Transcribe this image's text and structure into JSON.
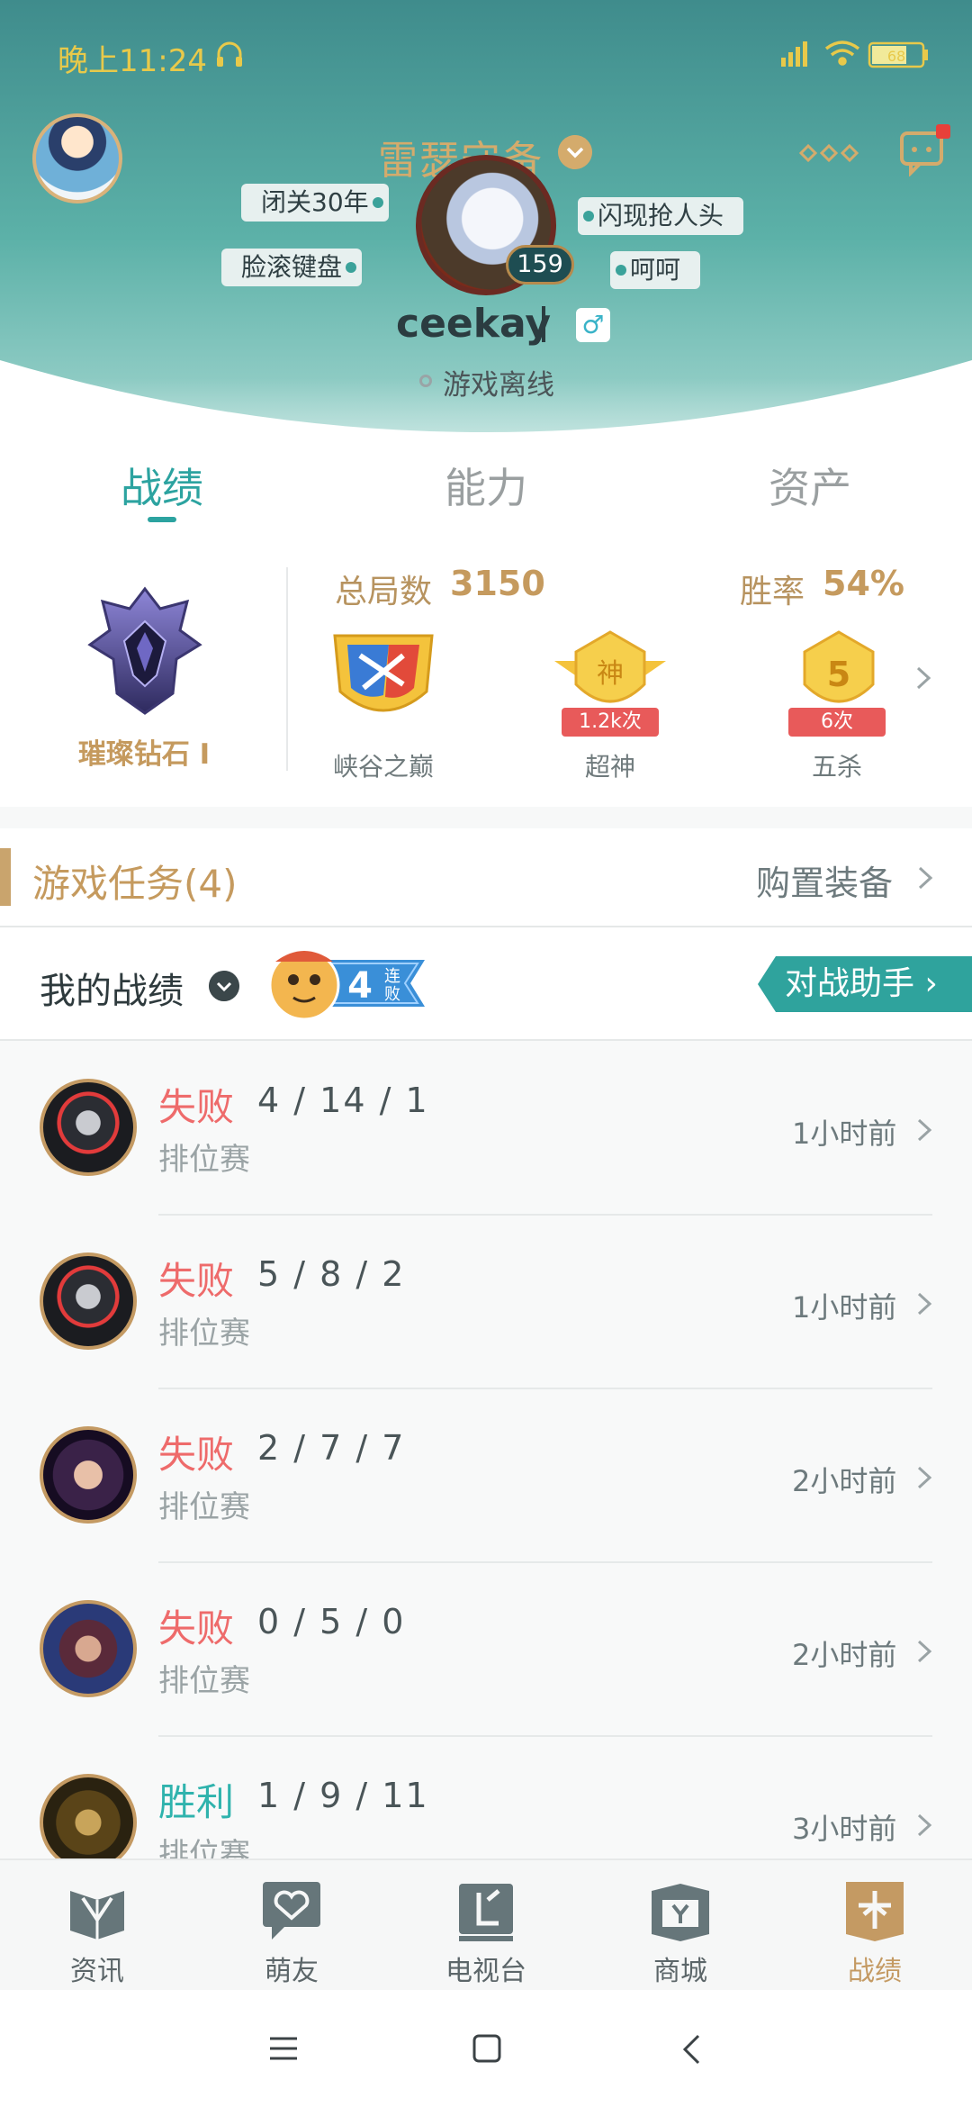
{
  "status_bar": {
    "time": "晚上11:24",
    "battery": "68"
  },
  "profile": {
    "server": "雷瑟守备",
    "player_name": "ceekay",
    "level": "159",
    "gender_symbol": "♂",
    "status": "游戏离线",
    "tags": [
      "闭关30年",
      "脸滚键盘",
      "闪现抢人头",
      "呵呵"
    ]
  },
  "tabs": [
    "战绩",
    "能力",
    "资产"
  ],
  "stats": {
    "rank_name": "璀璨钻石 I",
    "total_games_label": "总局数",
    "total_games_value": "3150",
    "win_rate_label": "胜率",
    "win_rate_value": "54%",
    "badges": [
      {
        "label": "峡谷之巅",
        "icon": "summit-crest-icon"
      },
      {
        "label": "超神",
        "icon": "legendary-shield-icon",
        "glyph": "神",
        "count": "1.2k次"
      },
      {
        "label": "五杀",
        "icon": "penta-kill-shield-icon",
        "glyph": "5",
        "count": "6次"
      }
    ]
  },
  "tasks": {
    "title": "游戏任务(4)",
    "action": "购置装备"
  },
  "record_header": {
    "title": "我的战绩",
    "streak_number": "4",
    "streak_line1": "连",
    "streak_line2": "败",
    "assistant_button": "对战助手 ›"
  },
  "matches": [
    {
      "result": "失败",
      "kda": "4 / 14 / 1",
      "mode": "排位赛",
      "time": "1小时前",
      "outcome": "loss"
    },
    {
      "result": "失败",
      "kda": "5 / 8 / 2",
      "mode": "排位赛",
      "time": "1小时前",
      "outcome": "loss"
    },
    {
      "result": "失败",
      "kda": "2 / 7 / 7",
      "mode": "排位赛",
      "time": "2小时前",
      "outcome": "loss"
    },
    {
      "result": "失败",
      "kda": "0 / 5 / 0",
      "mode": "排位赛",
      "time": "2小时前",
      "outcome": "loss"
    },
    {
      "result": "胜利",
      "kda": "1 / 9 / 11",
      "mode": "排位赛",
      "time": "3小时前",
      "outcome": "win"
    }
  ],
  "bottom_nav": [
    {
      "label": "资讯",
      "icon": "news-icon"
    },
    {
      "label": "萌友",
      "icon": "friends-icon"
    },
    {
      "label": "电视台",
      "icon": "tv-icon"
    },
    {
      "label": "商城",
      "icon": "store-icon"
    },
    {
      "label": "战绩",
      "icon": "record-icon"
    }
  ],
  "colors": {
    "accent": "#2ca3a0",
    "gold": "#c59a5e",
    "loss": "#ee6b6b",
    "win": "#2fb3ad"
  }
}
